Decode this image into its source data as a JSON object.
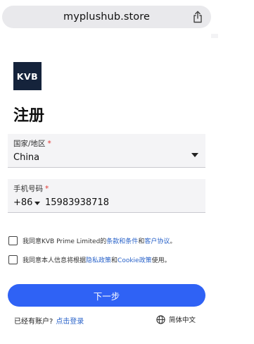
{
  "browser": {
    "url": "myplushub.store",
    "share_icon": "share-icon"
  },
  "brand": {
    "logo_text": "KVB",
    "logo_color": "#15233b"
  },
  "page": {
    "title": "注册"
  },
  "form": {
    "country": {
      "label": "国家/地区",
      "required_mark": "*",
      "value": "China"
    },
    "phone": {
      "label": "手机号码",
      "required_mark": "*",
      "country_code": "+86",
      "value": "15983938718"
    }
  },
  "agreements": {
    "terms": {
      "prefix": "我同意KVB Prime Limited的",
      "link1": "条款和条件",
      "middle": "和",
      "link2": "客户协议",
      "suffix": "。",
      "checked": false
    },
    "privacy": {
      "prefix": "我同意本人信息将根据",
      "link1": "隐私政策",
      "middle": "和",
      "link2": "Cookie政策",
      "suffix": "使用。",
      "checked": false
    }
  },
  "actions": {
    "next_label": "下一步",
    "next_color": "#2f62f5"
  },
  "footer": {
    "have_account": "已经有账户?",
    "login_link": "点击登录",
    "language_icon": "globe-icon",
    "language": "简体中文"
  },
  "colors": {
    "link": "#2a63c9",
    "required": "#e0342f"
  }
}
